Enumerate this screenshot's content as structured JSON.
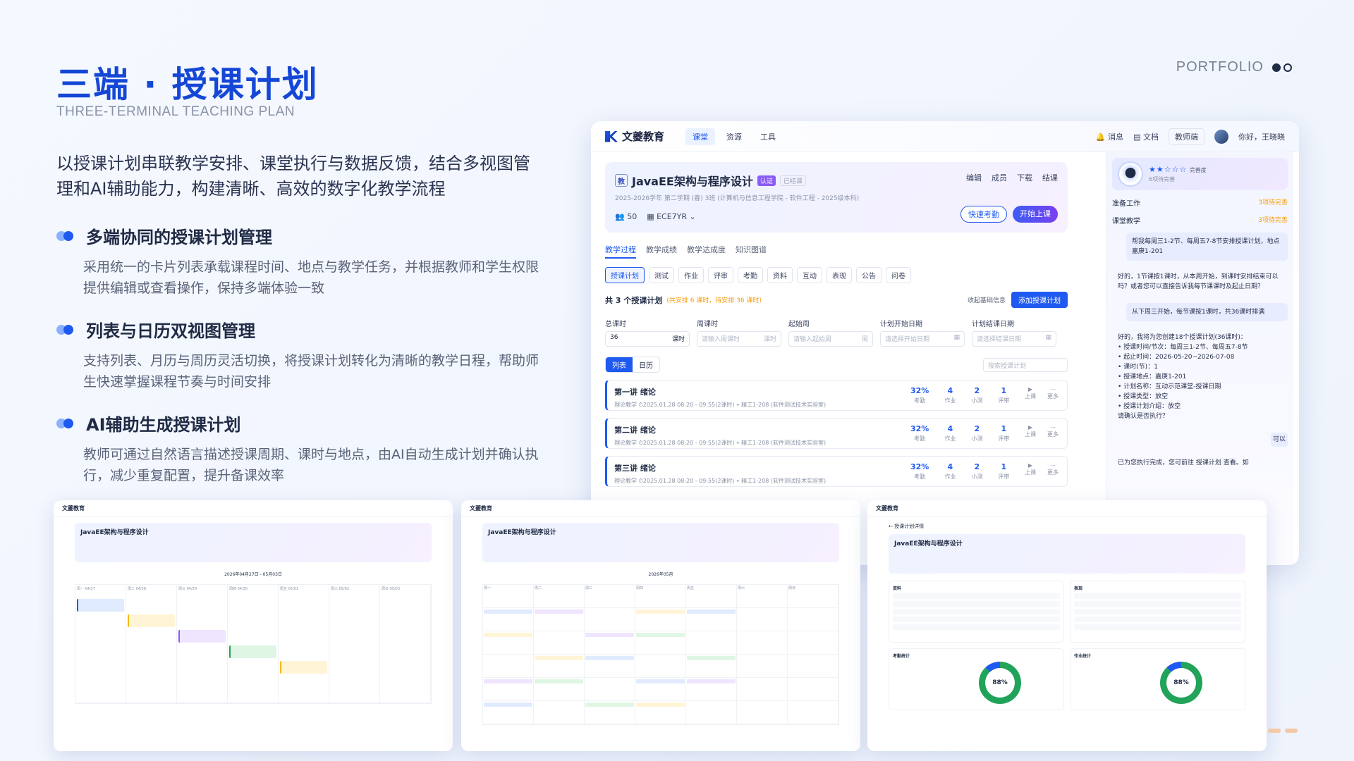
{
  "header": {
    "title": "三端 · 授课计划",
    "subtitle": "THREE-TERMINAL TEACHING PLAN",
    "portfolio": "PORTFOLIO"
  },
  "intro": "以授课计划串联教学安排、课堂执行与数据反馈，结合多视图管理和AI辅助能力，构建清晰、高效的数字化教学流程",
  "features": [
    {
      "title": "多端协同的授课计划管理",
      "desc": "采用统一的卡片列表承载课程时间、地点与教学任务，并根据教师和学生权限提供编辑或查看操作，保持多端体验一致"
    },
    {
      "title": "列表与日历双视图管理",
      "desc": "支持列表、月历与周历灵活切换，将授课计划转化为清晰的教学日程，帮助师生快速掌握课程节奏与时间安排"
    },
    {
      "title": "AI辅助生成授课计划",
      "desc": "教师可通过自然语言描述授课周期、课时与地点，由AI自动生成计划并确认执行，减少重复配置，提升备课效率"
    }
  ],
  "app": {
    "brand": "文夔教育",
    "nav": [
      "课堂",
      "资源",
      "工具"
    ],
    "topbar": {
      "msg": "消息",
      "doc": "文档",
      "role": "教师端",
      "user": "你好，王晓晓"
    },
    "course": {
      "icon": "教",
      "title": "JavaEE架构与程序设计",
      "badge": "认证",
      "status": "已结课",
      "meta": "2025-2026学年 第二学期 (春)   3班 (计算机与信息工程学院 - 软件工程 - 2025级本科)",
      "students": "50",
      "code": "ECE7YR",
      "actions": [
        "编辑",
        "成员",
        "下载",
        "结课"
      ],
      "quick": "快速考勤",
      "start": "开始上课"
    },
    "tabs": [
      "教学过程",
      "教学成绩",
      "教学达成度",
      "知识图谱"
    ],
    "subtabs": [
      "授课计划",
      "测试",
      "作业",
      "评审",
      "考勤",
      "资料",
      "互动",
      "表现",
      "公告",
      "问卷"
    ],
    "summary": {
      "title": "共 3 个授课计划",
      "note": "(共安排 6 课时，待安排 36 课时)",
      "collapse": "收起基础信息",
      "add": "添加授课计划"
    },
    "fields": [
      {
        "label": "总课时",
        "value": "36",
        "unit": "课时"
      },
      {
        "label": "周课时",
        "value": "请输入周课时",
        "unit": "课时"
      },
      {
        "label": "起始周",
        "value": "请输入起始周",
        "unit": "周"
      },
      {
        "label": "计划开始日期",
        "value": "请选择开始日期",
        "unit": ""
      },
      {
        "label": "计划结课日期",
        "value": "请选择结课日期",
        "unit": ""
      }
    ],
    "views": [
      "列表",
      "日历"
    ],
    "search_ph": "搜索授课计划",
    "lessons": [
      {
        "title": "第一讲 绪论",
        "meta": "理论教学   ⏱2025.01.28 08:20 - 09:55(2课时)   ⌖ 精工1-208 (软件测试技术实验室)"
      },
      {
        "title": "第二讲 绪论",
        "meta": "理论教学   ⏱2025.01.28 08:20 - 09:55(2课时)   ⌖ 精工1-208 (软件测试技术实验室)"
      },
      {
        "title": "第三讲 绪论",
        "meta": "理论教学   ⏱2025.01.28 08:20 - 09:55(2课时)   ⌖ 精工1-208 (软件测试技术实验室)"
      }
    ],
    "lesson_stats": [
      {
        "v": "32%",
        "k": "考勤"
      },
      {
        "v": "4",
        "k": "作业"
      },
      {
        "v": "2",
        "k": "小测"
      },
      {
        "v": "1",
        "k": "评审"
      }
    ],
    "lesson_ops": [
      "上课",
      "更多"
    ],
    "ai": {
      "score_label": "完善度",
      "sub": "6项待完善",
      "rows": [
        {
          "k": "准备工作",
          "v": "3项待完善"
        },
        {
          "k": "课堂教学",
          "v": "3项待完善"
        }
      ],
      "q1": "帮我每周三1-2节、每周五7-8节安排授课计划，地点嘉庚1-201",
      "a1": "好的，1节课按1课时，从本周开始，到课时安排结束可以吗？或者您可以直接告诉我每节课课时及起止日期？",
      "q2": "从下周三开始，每节课按1课时，共36课时排满",
      "a2": "好的，我将为您创建18个授课计划(36课时)：\n• 授课时间/节次：每周三1-2节、每周五7-8节\n• 起止时间：2026-05-20~2026-07-08\n• 课时(节)：1\n• 授课地点：嘉庚1-201\n• 计划名称：互动示范课堂-授课日期\n• 授课类型：放空\n• 授课计划介绍：放空\n请确认是否执行？",
      "ok": "可以",
      "done": "已为您执行完成，您可前往 授课计划 查看。如"
    }
  },
  "thumbs": [
    {
      "brand": "文夔教育",
      "course": "JavaEE架构与程序设计",
      "range": "2026年04月27日 - 05月03日",
      "days": [
        "周一 04/27",
        "周二 04/28",
        "周三 04/29",
        "周四 04/30",
        "周五 05/01",
        "周六 05/02",
        "周日 05/03"
      ]
    },
    {
      "brand": "文夔教育",
      "course": "JavaEE架构与程序设计",
      "range": "2026年05月",
      "days": [
        "周一",
        "周二",
        "周三",
        "周四",
        "周五",
        "周六",
        "周日"
      ]
    },
    {
      "brand": "文夔教育",
      "course": "JavaEE架构与程序设计",
      "back": "授课计划详情",
      "panels": [
        "资料",
        "表现",
        "考勤统计",
        "作业统计"
      ],
      "pct": "88%"
    }
  ]
}
